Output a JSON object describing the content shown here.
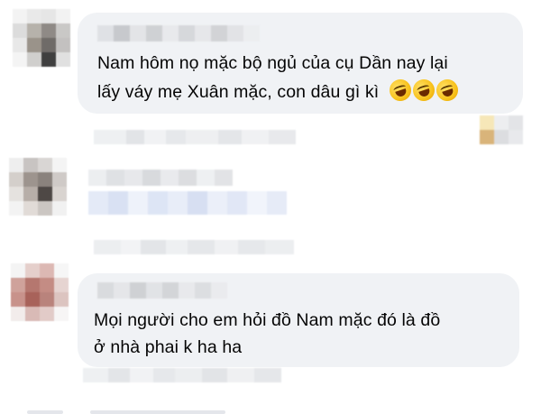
{
  "comments": [
    {
      "text_line1": "Nam hôm nọ mặc bộ ngủ của cụ Dần nay lại",
      "text_line2": "lấy váy mẹ Xuân mặc, con dâu gì kì",
      "emojis": [
        "rolling-on-floor-laughing",
        "rolling-on-floor-laughing",
        "rolling-on-floor-laughing"
      ]
    },
    {
      "text_line1": "",
      "text_line2": ""
    },
    {
      "text_line1": "Mọi người cho em hỏi đồ Nam mặc đó là đồ",
      "text_line2": "ở nhà phai k ha ha"
    }
  ],
  "colors": {
    "bubble": "#f0f2f5",
    "text": "#050505",
    "blur_light": "#e4e6eb",
    "blur_mid": "#c9ccd1"
  }
}
